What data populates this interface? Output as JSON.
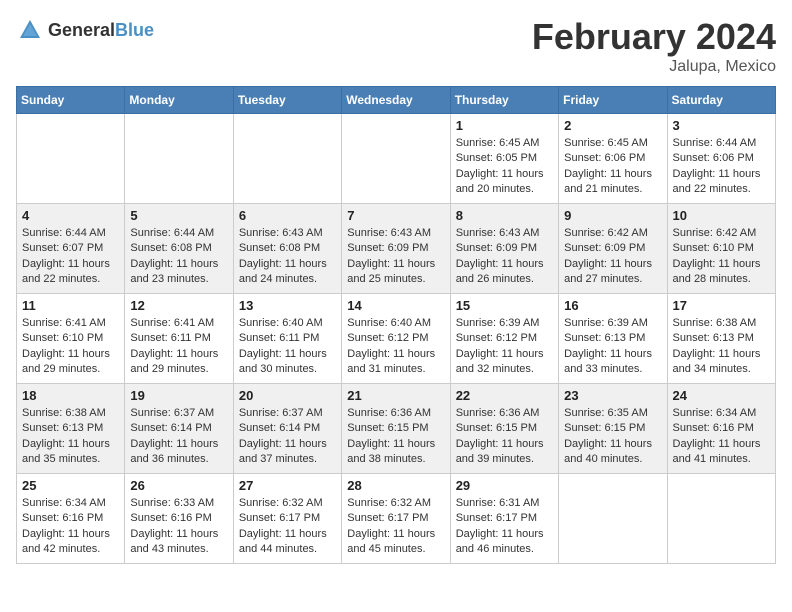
{
  "header": {
    "logo_general": "General",
    "logo_blue": "Blue",
    "month_title": "February 2024",
    "location": "Jalupa, Mexico"
  },
  "weekdays": [
    "Sunday",
    "Monday",
    "Tuesday",
    "Wednesday",
    "Thursday",
    "Friday",
    "Saturday"
  ],
  "weeks": [
    [
      {
        "day": "",
        "info": ""
      },
      {
        "day": "",
        "info": ""
      },
      {
        "day": "",
        "info": ""
      },
      {
        "day": "",
        "info": ""
      },
      {
        "day": "1",
        "info": "Sunrise: 6:45 AM\nSunset: 6:05 PM\nDaylight: 11 hours\nand 20 minutes."
      },
      {
        "day": "2",
        "info": "Sunrise: 6:45 AM\nSunset: 6:06 PM\nDaylight: 11 hours\nand 21 minutes."
      },
      {
        "day": "3",
        "info": "Sunrise: 6:44 AM\nSunset: 6:06 PM\nDaylight: 11 hours\nand 22 minutes."
      }
    ],
    [
      {
        "day": "4",
        "info": "Sunrise: 6:44 AM\nSunset: 6:07 PM\nDaylight: 11 hours\nand 22 minutes."
      },
      {
        "day": "5",
        "info": "Sunrise: 6:44 AM\nSunset: 6:08 PM\nDaylight: 11 hours\nand 23 minutes."
      },
      {
        "day": "6",
        "info": "Sunrise: 6:43 AM\nSunset: 6:08 PM\nDaylight: 11 hours\nand 24 minutes."
      },
      {
        "day": "7",
        "info": "Sunrise: 6:43 AM\nSunset: 6:09 PM\nDaylight: 11 hours\nand 25 minutes."
      },
      {
        "day": "8",
        "info": "Sunrise: 6:43 AM\nSunset: 6:09 PM\nDaylight: 11 hours\nand 26 minutes."
      },
      {
        "day": "9",
        "info": "Sunrise: 6:42 AM\nSunset: 6:09 PM\nDaylight: 11 hours\nand 27 minutes."
      },
      {
        "day": "10",
        "info": "Sunrise: 6:42 AM\nSunset: 6:10 PM\nDaylight: 11 hours\nand 28 minutes."
      }
    ],
    [
      {
        "day": "11",
        "info": "Sunrise: 6:41 AM\nSunset: 6:10 PM\nDaylight: 11 hours\nand 29 minutes."
      },
      {
        "day": "12",
        "info": "Sunrise: 6:41 AM\nSunset: 6:11 PM\nDaylight: 11 hours\nand 29 minutes."
      },
      {
        "day": "13",
        "info": "Sunrise: 6:40 AM\nSunset: 6:11 PM\nDaylight: 11 hours\nand 30 minutes."
      },
      {
        "day": "14",
        "info": "Sunrise: 6:40 AM\nSunset: 6:12 PM\nDaylight: 11 hours\nand 31 minutes."
      },
      {
        "day": "15",
        "info": "Sunrise: 6:39 AM\nSunset: 6:12 PM\nDaylight: 11 hours\nand 32 minutes."
      },
      {
        "day": "16",
        "info": "Sunrise: 6:39 AM\nSunset: 6:13 PM\nDaylight: 11 hours\nand 33 minutes."
      },
      {
        "day": "17",
        "info": "Sunrise: 6:38 AM\nSunset: 6:13 PM\nDaylight: 11 hours\nand 34 minutes."
      }
    ],
    [
      {
        "day": "18",
        "info": "Sunrise: 6:38 AM\nSunset: 6:13 PM\nDaylight: 11 hours\nand 35 minutes."
      },
      {
        "day": "19",
        "info": "Sunrise: 6:37 AM\nSunset: 6:14 PM\nDaylight: 11 hours\nand 36 minutes."
      },
      {
        "day": "20",
        "info": "Sunrise: 6:37 AM\nSunset: 6:14 PM\nDaylight: 11 hours\nand 37 minutes."
      },
      {
        "day": "21",
        "info": "Sunrise: 6:36 AM\nSunset: 6:15 PM\nDaylight: 11 hours\nand 38 minutes."
      },
      {
        "day": "22",
        "info": "Sunrise: 6:36 AM\nSunset: 6:15 PM\nDaylight: 11 hours\nand 39 minutes."
      },
      {
        "day": "23",
        "info": "Sunrise: 6:35 AM\nSunset: 6:15 PM\nDaylight: 11 hours\nand 40 minutes."
      },
      {
        "day": "24",
        "info": "Sunrise: 6:34 AM\nSunset: 6:16 PM\nDaylight: 11 hours\nand 41 minutes."
      }
    ],
    [
      {
        "day": "25",
        "info": "Sunrise: 6:34 AM\nSunset: 6:16 PM\nDaylight: 11 hours\nand 42 minutes."
      },
      {
        "day": "26",
        "info": "Sunrise: 6:33 AM\nSunset: 6:16 PM\nDaylight: 11 hours\nand 43 minutes."
      },
      {
        "day": "27",
        "info": "Sunrise: 6:32 AM\nSunset: 6:17 PM\nDaylight: 11 hours\nand 44 minutes."
      },
      {
        "day": "28",
        "info": "Sunrise: 6:32 AM\nSunset: 6:17 PM\nDaylight: 11 hours\nand 45 minutes."
      },
      {
        "day": "29",
        "info": "Sunrise: 6:31 AM\nSunset: 6:17 PM\nDaylight: 11 hours\nand 46 minutes."
      },
      {
        "day": "",
        "info": ""
      },
      {
        "day": "",
        "info": ""
      }
    ]
  ]
}
